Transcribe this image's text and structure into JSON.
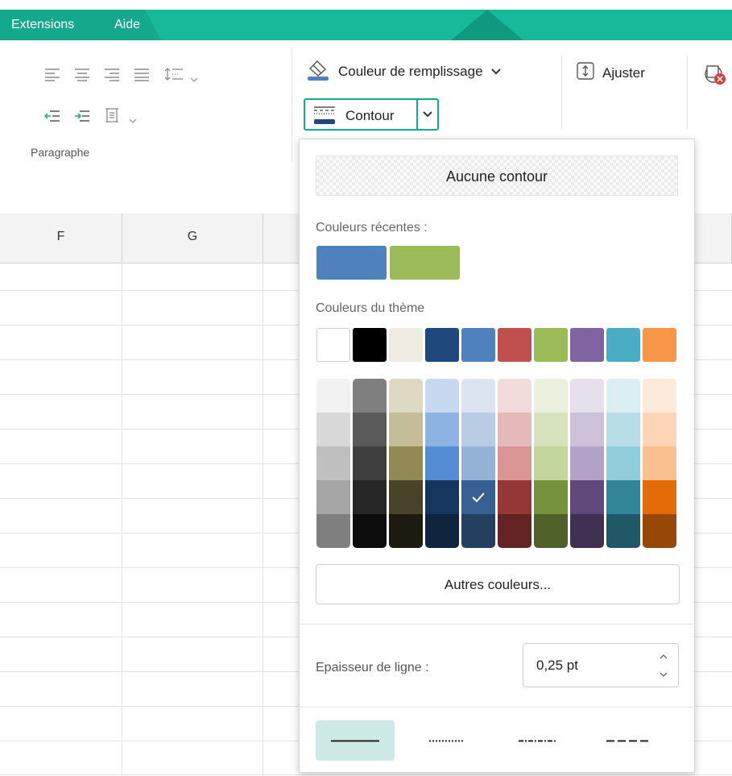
{
  "menu": {
    "items": [
      "Extensions",
      "Aide"
    ]
  },
  "ribbon": {
    "paragraph_group_label": "Paragraphe",
    "fill_color_label": "Couleur de remplissage",
    "outline_label": "Contour",
    "fit_label": "Ajuster"
  },
  "sheet": {
    "columns": [
      "F",
      "G"
    ]
  },
  "outline_panel": {
    "no_outline_label": "Aucune contour",
    "recent_colors_label": "Couleurs récentes :",
    "recent_colors": [
      "#4f81bd",
      "#9bbb59"
    ],
    "theme_colors_label": "Couleurs du thème",
    "theme_colors": [
      "#ffffff",
      "#000000",
      "#eeece1",
      "#1f497d",
      "#4f81bd",
      "#c0504d",
      "#9bbb59",
      "#8064a2",
      "#4bacc6",
      "#f79646"
    ],
    "shade_rows": [
      [
        "#f2f2f2",
        "#7f7f7f",
        "#ddd9c3",
        "#c6d9f0",
        "#dbe5f1",
        "#f2dcdb",
        "#ebf1dd",
        "#e5e0ec",
        "#dbeef3",
        "#fdeada"
      ],
      [
        "#d8d8d8",
        "#595959",
        "#c4bd97",
        "#8db3e2",
        "#b8cce4",
        "#e5b9b7",
        "#d7e3bc",
        "#ccc1d9",
        "#b7dde8",
        "#fbd5b5"
      ],
      [
        "#bfbfbf",
        "#3f3f3f",
        "#938953",
        "#548dd4",
        "#95b3d7",
        "#d99694",
        "#c3d69b",
        "#b2a2c7",
        "#92cddc",
        "#fac08f"
      ],
      [
        "#a5a5a5",
        "#262626",
        "#494429",
        "#17365d",
        "#366092",
        "#953734",
        "#76923c",
        "#5f497a",
        "#31859b",
        "#e36c09"
      ],
      [
        "#7f7f7f",
        "#0c0c0c",
        "#1d1b10",
        "#0f243e",
        "#244061",
        "#632423",
        "#4f6128",
        "#3f3151",
        "#205867",
        "#974806"
      ]
    ],
    "selected_shade": {
      "row": 3,
      "col": 4
    },
    "more_colors_label": "Autres couleurs...",
    "line_thickness_label": "Epaisseur de ligne :",
    "line_thickness_value": "0,25 pt",
    "line_styles": [
      "solid",
      "dotted",
      "dash-dot",
      "dashed"
    ],
    "selected_line_style": "solid"
  }
}
